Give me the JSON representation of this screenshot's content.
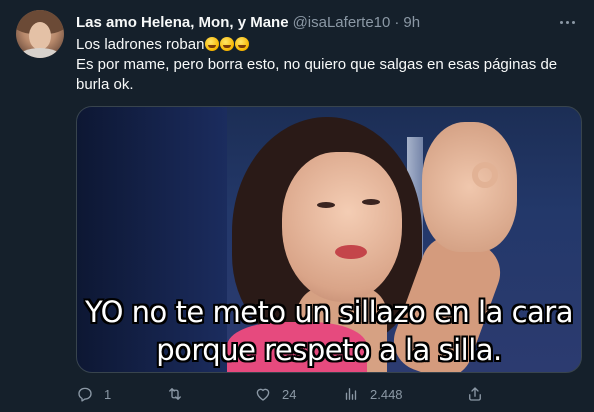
{
  "tweet": {
    "display_name": "Las amo Helena, Mon, y Mane",
    "handle": "@isaLaferte10",
    "separator": "·",
    "time": "9h",
    "text_lines": [
      "Los ladrones roban",
      "Es por mame, pero borra esto, no quiero que salgas en esas páginas de",
      "burla ok."
    ],
    "emojis": [
      "rolling-on-floor-laughing-emoji",
      "rolling-on-floor-laughing-emoji",
      "rolling-on-floor-laughing-emoji"
    ],
    "media": {
      "caption_line1": "YO no te meto un sillazo en la cara",
      "caption_line2": "porque respeto a la silla."
    },
    "actions": {
      "reply_count": "1",
      "retweet_count": "",
      "like_count": "24",
      "views_count": "2.448"
    }
  },
  "colors": {
    "background": "#15202b",
    "text": "#f7f9f9",
    "muted": "#8b98a5",
    "border": "#38444d"
  }
}
